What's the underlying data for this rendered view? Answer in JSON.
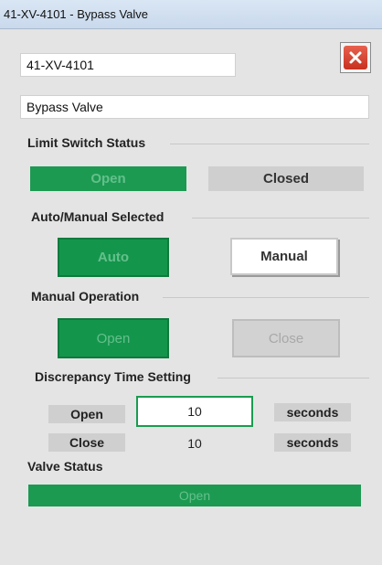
{
  "window": {
    "title": "41-XV-4101 - Bypass Valve"
  },
  "fields": {
    "tag": "41-XV-4101",
    "description": "Bypass Valve"
  },
  "icons": {
    "close": "close-icon"
  },
  "limit_switch": {
    "title": "Limit Switch Status",
    "open_label": "Open",
    "closed_label": "Closed"
  },
  "auto_manual": {
    "title": "Auto/Manual Selected",
    "auto_label": "Auto",
    "manual_label": "Manual"
  },
  "manual_operation": {
    "title": "Manual Operation",
    "open_label": "Open",
    "close_label": "Close"
  },
  "discrepancy": {
    "title": "Discrepancy Time Setting",
    "rows": [
      {
        "label": "Open",
        "value": "10",
        "unit": "seconds"
      },
      {
        "label": "Close",
        "value": "10",
        "unit": "seconds"
      }
    ]
  },
  "valve_status": {
    "title": "Valve Status",
    "value": "Open"
  },
  "colors": {
    "active_green": "#1c9a52",
    "inactive_grey": "#cfcfcf",
    "close_red": "#d43a27"
  }
}
